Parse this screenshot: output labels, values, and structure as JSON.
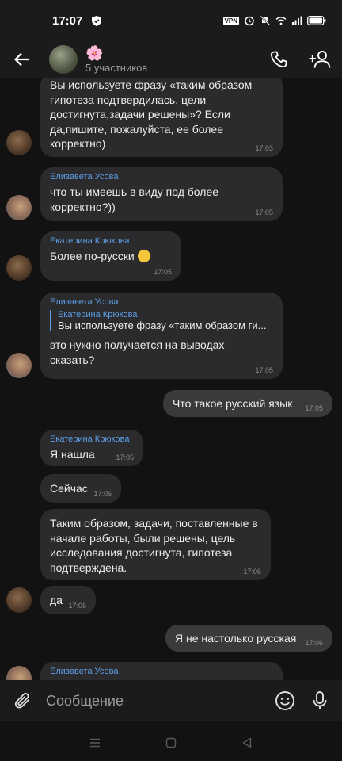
{
  "status": {
    "time": "17:07",
    "vpn": "VPN"
  },
  "header": {
    "title": "🌸",
    "subtitle": "5 участников"
  },
  "messages": [
    {
      "text": "Вы используете фразу «таким образом гипотеза подтвердилась, цели достигнута,задачи решены»? Если да,пишите, пожалуйста, ее более корректно)",
      "time": "17:03"
    },
    {
      "sender": "Елизавета Усова",
      "text": "что ты имеешь в виду под более корректно?))",
      "time": "17:05"
    },
    {
      "sender": "Екатерина Крюкова",
      "text": "Более по-русски",
      "time": "17:05"
    },
    {
      "sender": "Елизавета Усова",
      "quote_name": "Екатерина Крюкова",
      "quote_text": "Вы используете фразу «таким образом ги...",
      "text": "это нужно получается на выводах сказать?",
      "time": "17:05"
    },
    {
      "text": "Что такое русский язык",
      "time": "17:05"
    },
    {
      "sender": "Екатерина Крюкова",
      "text": "Я нашла",
      "time": "17:05"
    },
    {
      "text": "Сейчас",
      "time": "17:05"
    },
    {
      "text": "Таким образом, задачи, поставленные в начале работы, были решены, цель исследования достигнута, гипотеза подтверждена.",
      "time": "17:06"
    },
    {
      "text": "да",
      "time": "17:06"
    },
    {
      "text": "Я не настолько русская",
      "time": "17:06"
    },
    {
      "sender": "Елизавета Усова"
    }
  ],
  "composer": {
    "placeholder": "Сообщение"
  }
}
